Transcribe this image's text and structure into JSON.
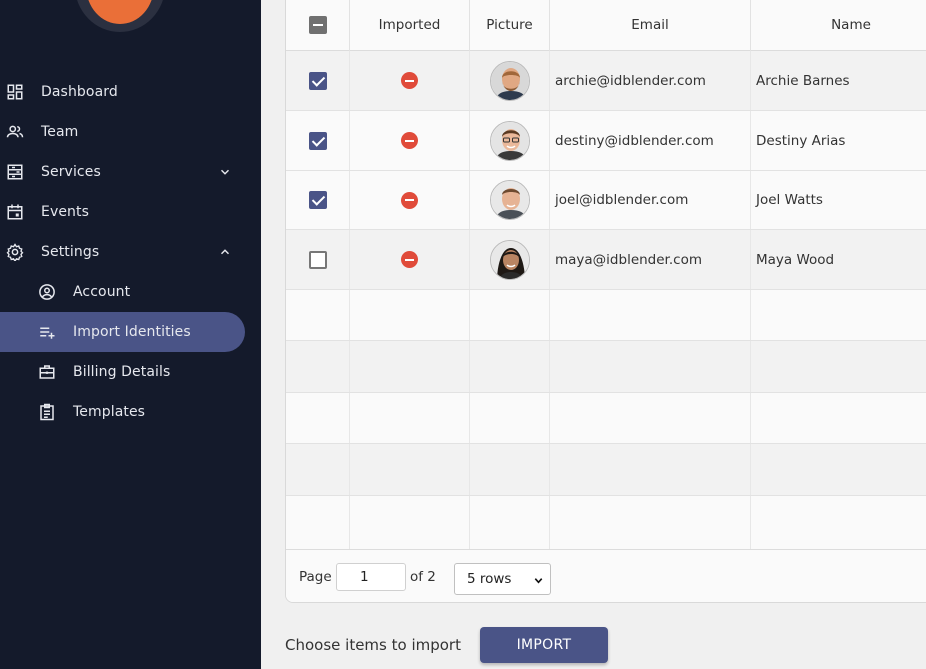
{
  "sidebar": {
    "nav": [
      {
        "label": "Dashboard",
        "icon": "dashboard-icon"
      },
      {
        "label": "Team",
        "icon": "team-icon"
      },
      {
        "label": "Services",
        "icon": "services-icon"
      },
      {
        "label": "Events",
        "icon": "events-icon"
      },
      {
        "label": "Settings",
        "icon": "settings-icon"
      }
    ],
    "settings_sub": [
      {
        "label": "Account",
        "icon": "account-icon"
      },
      {
        "label": "Import Identities",
        "icon": "playlist-add-icon"
      },
      {
        "label": "Billing Details",
        "icon": "briefcase-icon"
      },
      {
        "label": "Templates",
        "icon": "clipboard-icon"
      }
    ],
    "active": "Import Identities",
    "colors": {
      "bg": "#141a2b",
      "active": "#4a5487",
      "logo": "#ea6f38"
    }
  },
  "table": {
    "columns": [
      "Imported",
      "Picture",
      "Email",
      "Name"
    ],
    "rows": [
      {
        "checked": true,
        "email": "archie@idblender.com",
        "name": "Archie Barnes",
        "avatar": "man-bearded-avatar"
      },
      {
        "checked": true,
        "email": "destiny@idblender.com",
        "name": "Destiny Arias",
        "avatar": "man-glasses-avatar"
      },
      {
        "checked": true,
        "email": "joel@idblender.com",
        "name": "Joel Watts",
        "avatar": "man-avatar"
      },
      {
        "checked": false,
        "email": "maya@idblender.com",
        "name": "Maya Wood",
        "avatar": "woman-avatar"
      }
    ],
    "imported_status_icon": "minus-circle-icon",
    "status_color": "#e04b3a"
  },
  "pager": {
    "page_label": "Page",
    "page_value": "1",
    "of_label": "of 2",
    "rows_option": "5 rows"
  },
  "footer": {
    "choose_label": "Choose items to import",
    "import_label": "IMPORT"
  }
}
